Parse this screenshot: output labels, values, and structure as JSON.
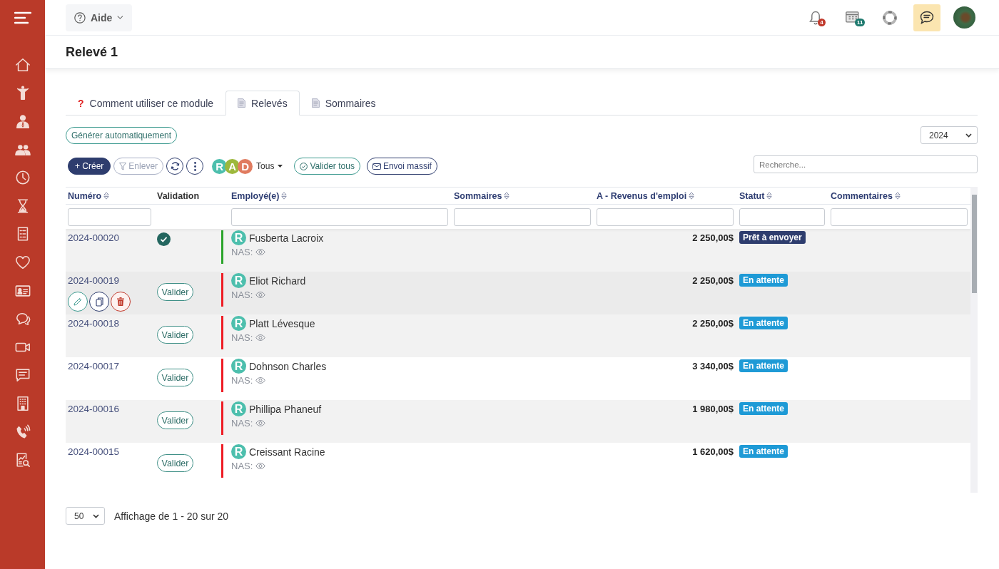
{
  "topbar": {
    "help_menu": {
      "label": "Aide"
    },
    "notifications": {
      "badge": "4"
    },
    "schedule": {
      "badge": "11"
    },
    "chat": {
      "active": true
    }
  },
  "page_title": "Relevé 1",
  "tabs": [
    {
      "kind": "help",
      "symbol": "?",
      "label": "Comment utiliser ce module",
      "selected": false
    },
    {
      "kind": "document",
      "label": "Relevés",
      "selected": true
    },
    {
      "kind": "document",
      "label": "Sommaires",
      "selected": false
    }
  ],
  "toolbar": {
    "generate_button": "Générer automatiquement",
    "year_select": {
      "value": "2024"
    },
    "create_button": "+ Créer",
    "remove_button": {
      "label": "Enlever",
      "disabled": true
    },
    "type_filters": [
      {
        "letter": "R",
        "color": "#4dbfad"
      },
      {
        "letter": "A",
        "color": "#9db83c"
      },
      {
        "letter": "D",
        "color": "#e07b5f"
      }
    ],
    "type_dropdown": "Tous",
    "validate_all_button": "Valider tous",
    "bulk_send_button": "Envoi massif",
    "search": {
      "placeholder": "Recherche..."
    }
  },
  "table": {
    "columns": [
      {
        "label": "Numéro",
        "sortable": true,
        "filter": true
      },
      {
        "label": "Validation",
        "sortable": false,
        "filter": false
      },
      {
        "label": "Employé(e)",
        "sortable": true,
        "filter": true
      },
      {
        "label": "Sommaires",
        "sortable": true,
        "filter": true
      },
      {
        "label": "A - Revenus d'emploi",
        "sortable": true,
        "filter": true
      },
      {
        "label": "Statut",
        "sortable": true,
        "filter": true
      },
      {
        "label": "Commentaires",
        "sortable": true,
        "filter": true
      }
    ],
    "rows": [
      {
        "number": "2024-00020",
        "validated": true,
        "hovered": false,
        "marker": {
          "color": "#2ca52c"
        },
        "avatar": "R",
        "employee": "Fusberta Lacroix",
        "nas_label": "NAS:",
        "amount": "2 250,00$",
        "status": {
          "label": "Prêt à envoyer",
          "color": "#2e3d6e"
        }
      },
      {
        "number": "2024-00019",
        "validated": false,
        "validate_label": "Valider",
        "hovered": true,
        "marker": {
          "color": "#ee1c24"
        },
        "avatar": "R",
        "employee": "Eliot Richard",
        "nas_label": "NAS:",
        "amount": "2 250,00$",
        "status": {
          "label": "En attente",
          "color": "#1e9ad6"
        }
      },
      {
        "number": "2024-00018",
        "validated": false,
        "validate_label": "Valider",
        "hovered": false,
        "marker": {
          "color": "#ee1c24"
        },
        "avatar": "R",
        "employee": "Platt Lévesque",
        "nas_label": "NAS:",
        "amount": "2 250,00$",
        "status": {
          "label": "En attente",
          "color": "#1e9ad6"
        }
      },
      {
        "number": "2024-00017",
        "validated": false,
        "validate_label": "Valider",
        "hovered": false,
        "marker": {
          "color": "#ee1c24"
        },
        "avatar": "R",
        "employee": "Dohnson Charles",
        "nas_label": "NAS:",
        "amount": "3 340,00$",
        "status": {
          "label": "En attente",
          "color": "#1e9ad6"
        }
      },
      {
        "number": "2024-00016",
        "validated": false,
        "validate_label": "Valider",
        "hovered": false,
        "marker": {
          "color": "#ee1c24"
        },
        "avatar": "R",
        "employee": "Phillipa Phaneuf",
        "nas_label": "NAS:",
        "amount": "1 980,00$",
        "status": {
          "label": "En attente",
          "color": "#1e9ad6"
        }
      },
      {
        "number": "2024-00015",
        "validated": false,
        "validate_label": "Valider",
        "hovered": false,
        "marker": {
          "color": "#ee1c24"
        },
        "avatar": "R",
        "employee": "Creissant Racine",
        "nas_label": "NAS:",
        "amount": "1 620,00$",
        "status": {
          "label": "En attente",
          "color": "#1e9ad6"
        }
      }
    ]
  },
  "pagination": {
    "page_size": "50",
    "summary": "Affichage de 1 - 20 sur 20"
  }
}
